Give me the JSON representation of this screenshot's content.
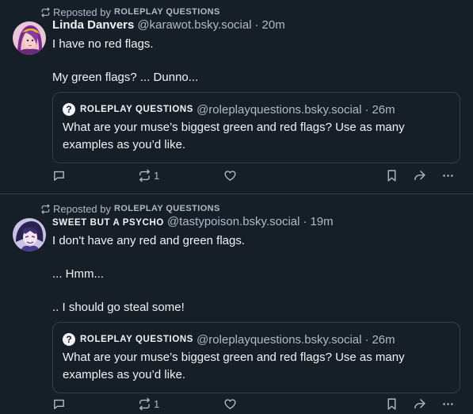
{
  "posts": [
    {
      "repost_label": "Reposted by",
      "reposted_by": "Roleplay Questions",
      "author_name": "Linda Danvers",
      "author_handle": "@karawot.bsky.social",
      "time": "20m",
      "text": "I have no red flags.\n\nMy green flags? ... Dunno...",
      "quote": {
        "author_name": "Roleplay Questions",
        "author_handle": "@roleplayquestions.bsky.social",
        "time": "26m",
        "text": "What are your muse’s biggest green and red flags? Use as many examples as you’d like."
      },
      "actions": {
        "reply_count": "",
        "repost_count": "1",
        "like_count": ""
      }
    },
    {
      "repost_label": "Reposted by",
      "reposted_by": "Roleplay Questions",
      "author_name": "Sweet but a Psycho",
      "author_handle": "@tastypoison.bsky.social",
      "time": "19m",
      "text": "I don't have any red and green flags.\n\n... Hmm...\n\n.. I should go steal some!",
      "quote": {
        "author_name": "Roleplay Questions",
        "author_handle": "@roleplayquestions.bsky.social",
        "time": "26m",
        "text": "What are your muse’s biggest green and red flags? Use as many examples as you’d like."
      },
      "actions": {
        "reply_count": "",
        "repost_count": "1",
        "like_count": ""
      }
    }
  ],
  "colors": {
    "background": "#161e27",
    "border": "#2e4052",
    "muted_text": "#aebbc9",
    "primary_text": "#f1f3f5"
  }
}
